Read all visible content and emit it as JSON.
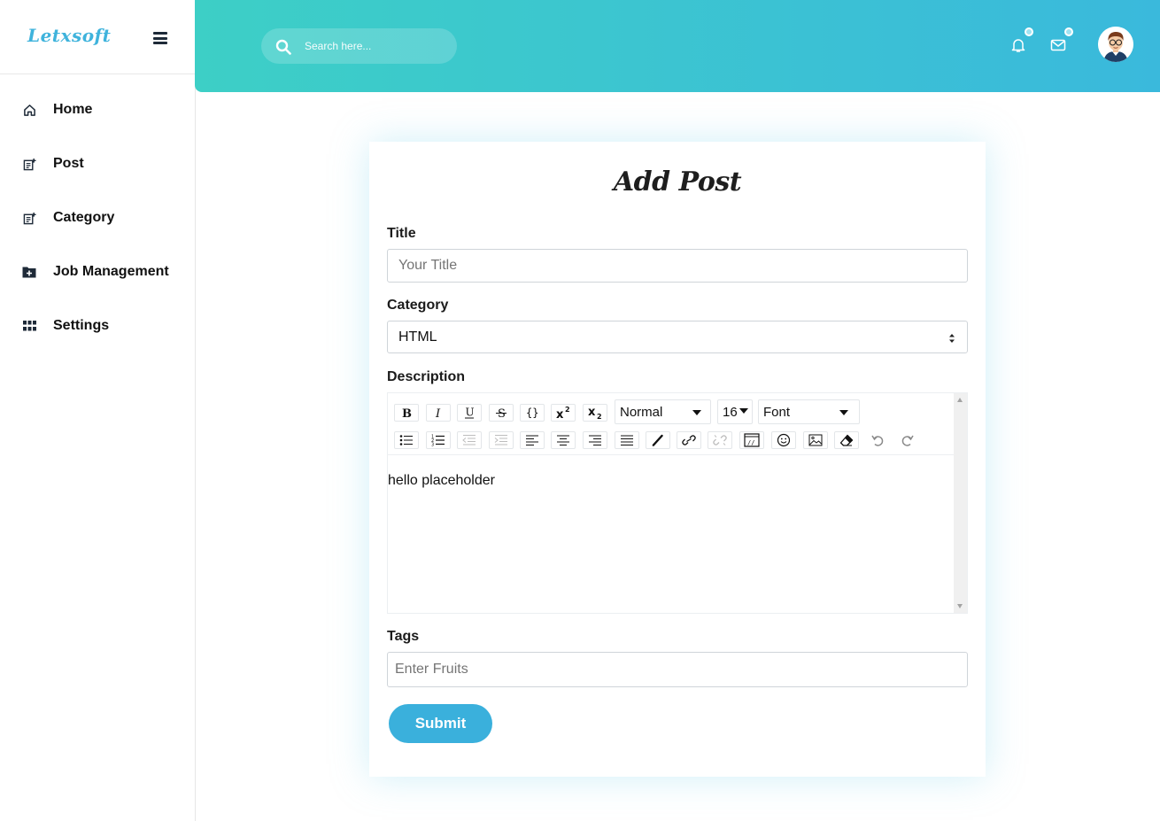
{
  "brand": {
    "logo": "Letxsoft"
  },
  "sidebar": {
    "items": [
      {
        "label": "Home",
        "icon": "home-icon"
      },
      {
        "label": "Post",
        "icon": "post-icon"
      },
      {
        "label": "Category",
        "icon": "category-icon"
      },
      {
        "label": "Job Management",
        "icon": "folder-plus-icon"
      },
      {
        "label": "Settings",
        "icon": "grid-icon"
      }
    ]
  },
  "header": {
    "search_placeholder": "Search here...",
    "accent_start": "#3dcfc6",
    "accent_end": "#3ab9dc"
  },
  "form": {
    "title": "Add Post",
    "title_label": "Title",
    "title_placeholder": "Your Title",
    "category_label": "Category",
    "category_value": "HTML",
    "description_label": "Description",
    "editor": {
      "format_value": "Normal",
      "size_value": "16",
      "font_value": "Font",
      "content": "hello placeholder"
    },
    "tags_label": "Tags",
    "tags_placeholder": "Enter Fruits",
    "submit_label": "Submit"
  }
}
